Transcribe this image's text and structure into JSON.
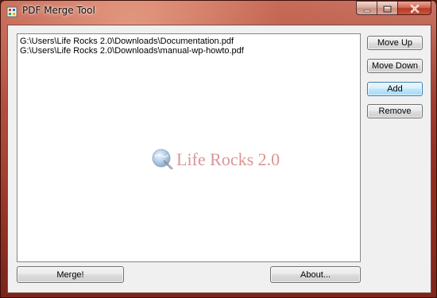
{
  "window": {
    "title": "PDF Merge Tool"
  },
  "files": [
    "G:\\Users\\Life Rocks 2.0\\Downloads\\Documentation.pdf",
    "G:\\Users\\Life Rocks 2.0\\Downloads\\manual-wp-howto.pdf"
  ],
  "buttons": {
    "move_up": "Move Up",
    "move_down": "Move Down",
    "add": "Add",
    "remove": "Remove",
    "merge": "Merge!",
    "about": "About..."
  },
  "watermark": {
    "text": "Life Rocks 2.0"
  },
  "icons": {
    "app": "app-icon",
    "minimize": "minimize-icon",
    "maximize": "maximize-icon",
    "close": "close-icon",
    "watermark_logo": "globe-icon"
  }
}
